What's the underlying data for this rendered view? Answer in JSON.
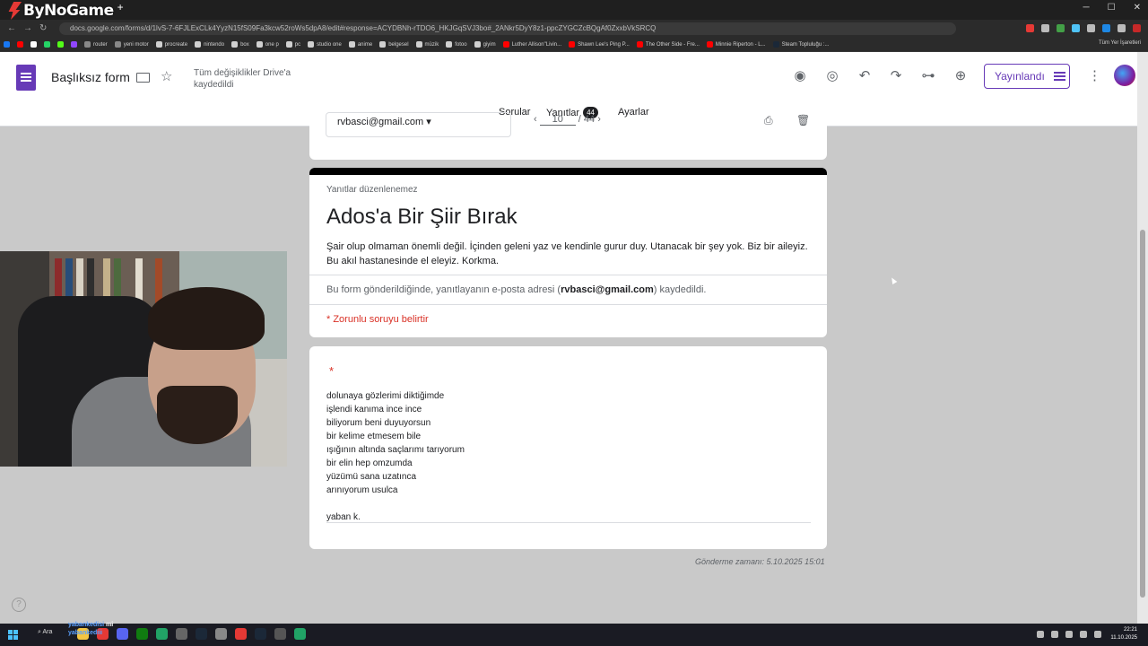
{
  "browser": {
    "logo_text": "ByNoGame",
    "logo_plus": "+",
    "url": "docs.google.com/forms/d/1lvS-7-6FJLExCLk4YyzN15fS09Fa3kcw52roWs5dpA8/edit#response=ACYDBNh-rTDO6_HKJGqSVJ3bo#_2ANkr5DyY8z1-ppcZYGCZcBQgAf0ZxxbVkSRCQ",
    "bookmarks": [
      "router",
      "yeni motor",
      "procreate",
      "nintendo",
      "box",
      "one p",
      "pc",
      "studio one",
      "anime",
      "belgesel",
      "müzik",
      "fotoo",
      "giyim",
      "Luther Allison\"Livin...",
      "Shawn Lee's Ping P...",
      "The Other Side - Fre...",
      "Minnie Riperton - L...",
      "Steam Topluluğu :..."
    ],
    "bookmarks_right": "Tüm Yer İşaretleri"
  },
  "forms_header": {
    "title": "Başlıksız form",
    "saved_status": "Tüm değişiklikler Drive'a kaydedildi",
    "publish_label": "Yayınlandı",
    "tabs": [
      {
        "label": "Sorular"
      },
      {
        "label": "Yanıtlar",
        "count": "44"
      },
      {
        "label": "Ayarlar"
      }
    ]
  },
  "response_nav": {
    "email": "rvbasci@gmail.com",
    "current": "10",
    "separator": "/",
    "total": "44"
  },
  "form": {
    "note": "Yanıtlar düzenlenemez",
    "title": "Ados'a Bir Şiir Bırak",
    "description": "Şair olup olmaman önemli değil. İçinden geleni yaz ve kendinle gurur duy. Utanacak bir şey yok. Biz bir aileyiz. Bu akıl hastanesinde el eleyiz. Korkma.",
    "email_note_prefix": "Bu form gönderildiğinde, yanıtlayanın e-posta adresi (",
    "email_note_email": "rvbasci@gmail.com",
    "email_note_suffix": ") kaydedildi.",
    "required_note": "* Zorunlu soruyu belirtir"
  },
  "answer": {
    "required_star": "*",
    "lines": [
      "dolunaya gözlerimi diktiğimde",
      "işlendi kanıma ince ince",
      "biliyorum beni duyuyorsun",
      "bir kelime etmesem bile",
      "ışığının altında saçlarımı tarıyorum",
      "bir elin hep omzumda",
      "yüzümü sana uzatınca",
      "arınıyorum usulca",
      "",
      "yaban k."
    ]
  },
  "submitted_at": "Gönderme zamanı: 5.10.2025 15:01",
  "help_icon": "?",
  "taskbar": {
    "search_label": "Ara",
    "overlay_line1": "yabankedisi",
    "overlay_line1_suffix": "mi",
    "overlay_line2": "yabankediii",
    "clock_time": "22:21",
    "clock_date": "11.10.2025"
  }
}
